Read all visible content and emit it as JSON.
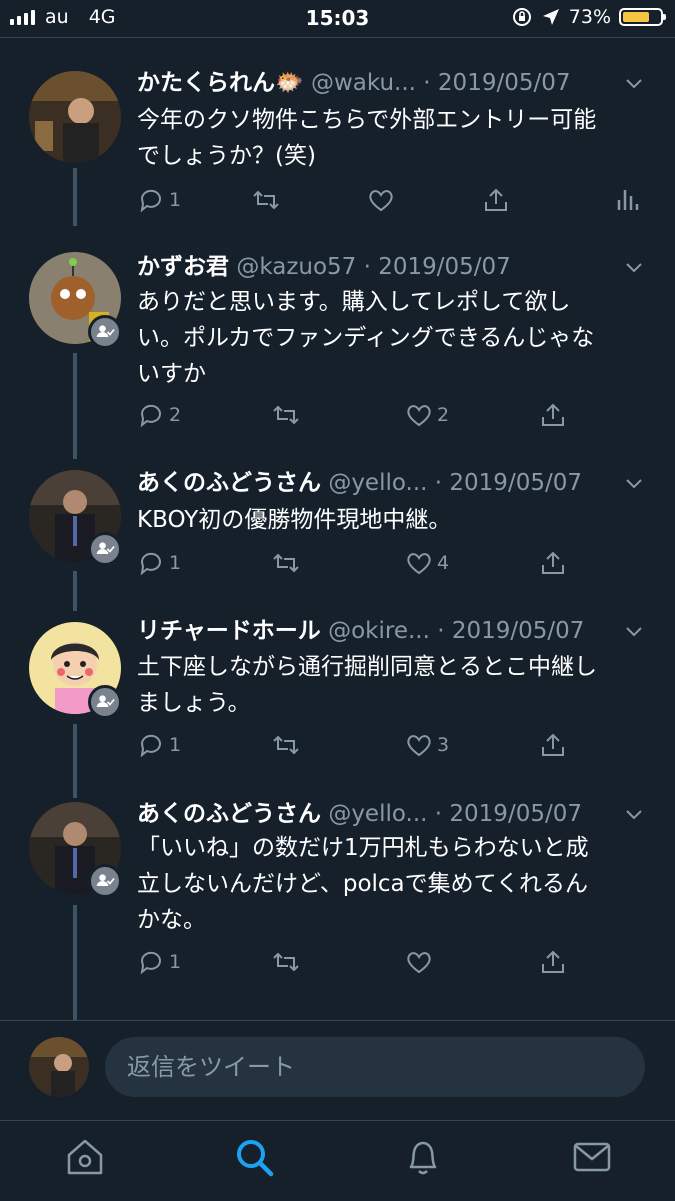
{
  "status_bar": {
    "carrier": "au",
    "network": "4G",
    "time": "15:03",
    "battery_percent": "73%",
    "battery_level": 0.73
  },
  "tweets": [
    {
      "name": "かたくられん🐡",
      "handle": "@waku...",
      "sep": " · ",
      "date": "2019/05/07",
      "lines": [
        "今年のクソ物件こちらで外部エントリー可能",
        "でしょうか？(笑)"
      ],
      "replies": "1",
      "retweets": "",
      "likes": ""
    },
    {
      "name": "かずお君",
      "handle": "@kazuo57",
      "sep": " · ",
      "date": "2019/05/07",
      "lines": [
        "ありだと思います。購入してレポして欲し",
        "い。ポルカでファンディングできるんじゃな",
        "いすか"
      ],
      "replies": "2",
      "retweets": "",
      "likes": "2"
    },
    {
      "name": "あくのふどうさん",
      "handle": "@yello...",
      "sep": " · ",
      "date": "2019/05/07",
      "lines": [
        "KBOY初の優勝物件現地中継。"
      ],
      "replies": "1",
      "retweets": "",
      "likes": "4"
    },
    {
      "name": "リチャードホール",
      "handle": "@okire...",
      "sep": " · ",
      "date": "2019/05/07",
      "lines": [
        "土下座しながら通行掘削同意とるとこ中継し",
        "ましょう。"
      ],
      "replies": "1",
      "retweets": "",
      "likes": "3"
    },
    {
      "name": "あくのふどうさん",
      "handle": "@yello...",
      "sep": " · ",
      "date": "2019/05/07",
      "lines": [
        "「いいね」の数だけ1万円札もらわないと成",
        "立しないんだけど、polcaで集めてくれるん",
        "かな。"
      ],
      "replies": "1",
      "retweets": "",
      "likes": ""
    }
  ],
  "compose": {
    "placeholder": "返信をツイート"
  },
  "tabs": [
    "home-icon",
    "search-icon",
    "notifications-icon",
    "messages-icon"
  ],
  "colors": {
    "background": "#15202b",
    "muted": "#8899a6",
    "accent": "#1da1f2",
    "battery": "#f5c542"
  }
}
